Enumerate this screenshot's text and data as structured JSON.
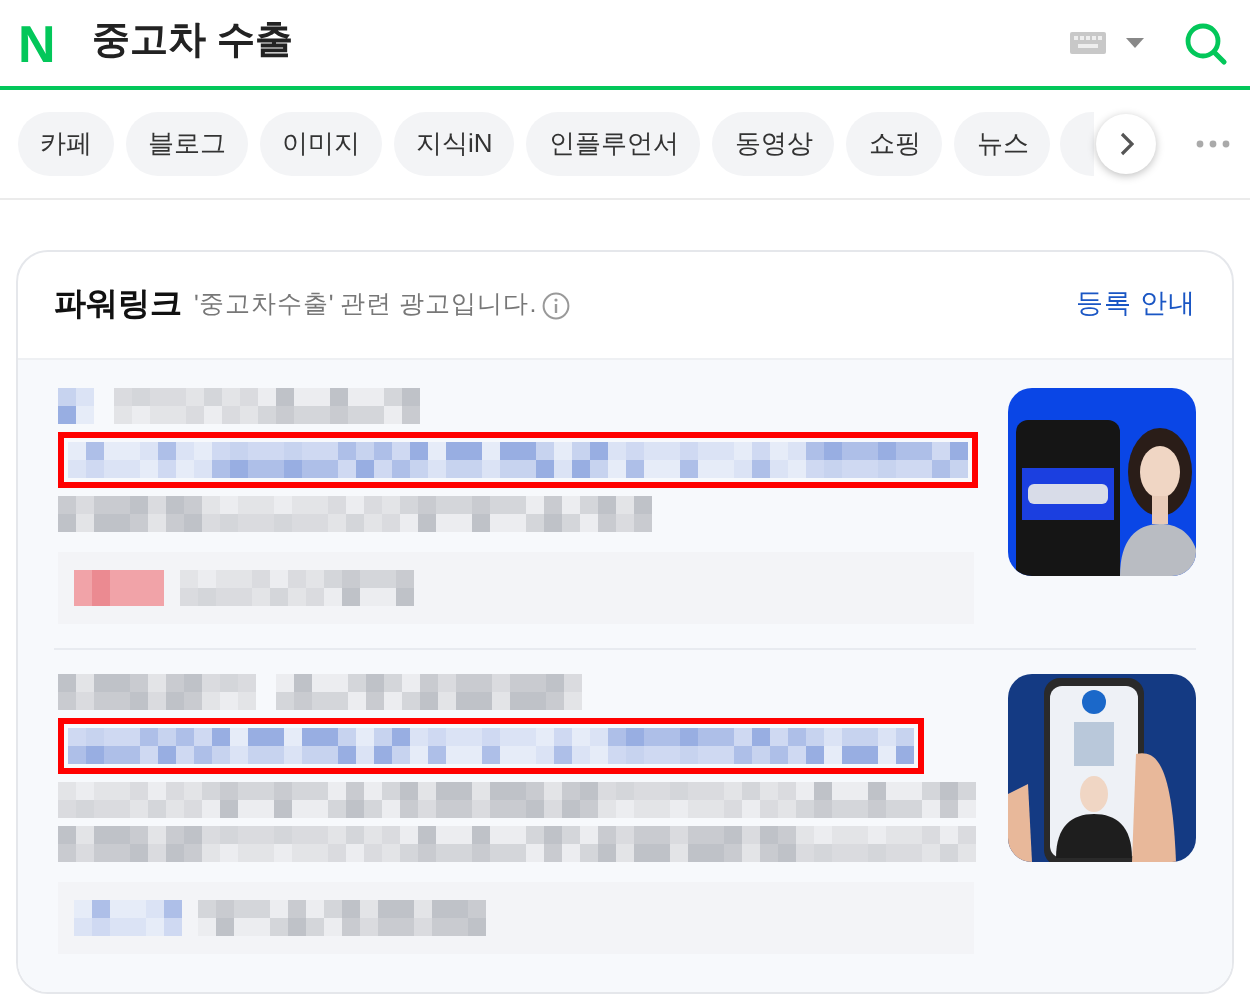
{
  "search": {
    "logo": "N",
    "query": "중고차 수출"
  },
  "tabs": [
    {
      "label": "카페",
      "selected": false
    },
    {
      "label": "블로그",
      "selected": false
    },
    {
      "label": "이미지",
      "selected": false
    },
    {
      "label": "지식iN",
      "selected": false
    },
    {
      "label": "인플루언서",
      "selected": false
    },
    {
      "label": "동영상",
      "selected": false
    },
    {
      "label": "쇼핑",
      "selected": false
    },
    {
      "label": "뉴스",
      "selected": false
    }
  ],
  "powerlink": {
    "title": "파워링크",
    "subtitle": "'중고차수출' 관련 광고입니다.",
    "register_link": "등록 안내",
    "ads": [
      {
        "highlighted": true
      },
      {
        "highlighted": true
      }
    ]
  }
}
